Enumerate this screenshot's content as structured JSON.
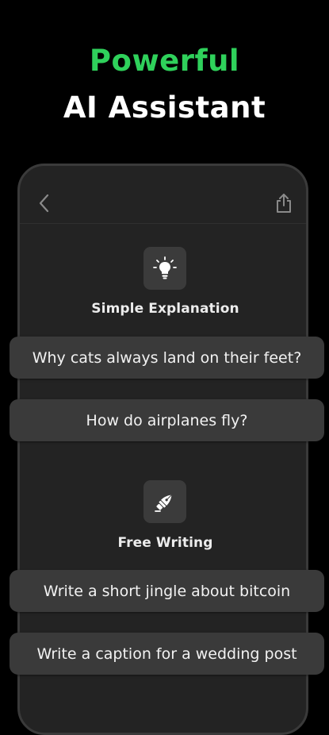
{
  "headline": {
    "line1": "Powerful",
    "line2": "AI Assistant"
  },
  "colors": {
    "accent": "#2fd15b",
    "background": "#000000",
    "card": "#3a3a3a",
    "phone": "#232323"
  },
  "nav": {
    "back_icon": "chevron-left-icon",
    "share_icon": "share-icon"
  },
  "sections": [
    {
      "icon": "lightbulb-icon",
      "title": "Simple Explanation",
      "prompts": [
        "Why cats always land on their feet?",
        "How do airplanes fly?"
      ]
    },
    {
      "icon": "fountain-pen-icon",
      "title": "Free Writing",
      "prompts": [
        "Write a short jingle about bitcoin",
        "Write a caption for a wedding post"
      ]
    }
  ]
}
